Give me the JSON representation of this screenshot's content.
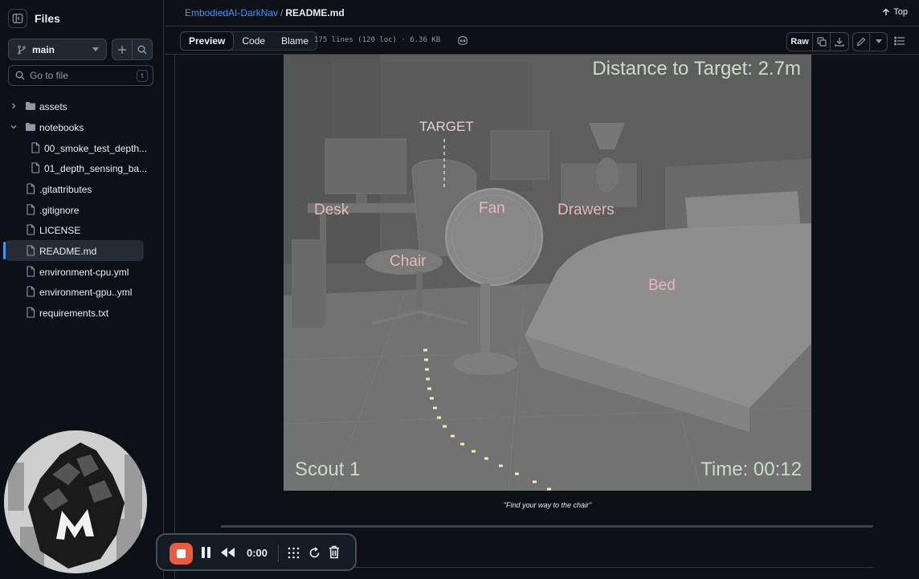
{
  "sidebar": {
    "title": "Files",
    "branch": "main",
    "goto_placeholder": "Go to file",
    "goto_shortcut": "t",
    "tree": [
      {
        "label": "assets",
        "type": "folder",
        "expanded": false
      },
      {
        "label": "notebooks",
        "type": "folder",
        "expanded": true
      },
      {
        "label": "00_smoke_test_depth...",
        "type": "file"
      },
      {
        "label": "01_depth_sensing_ba...",
        "type": "file"
      },
      {
        "label": ".gitattributes",
        "type": "file"
      },
      {
        "label": ".gitignore",
        "type": "file"
      },
      {
        "label": "LICENSE",
        "type": "file"
      },
      {
        "label": "README.md",
        "type": "file",
        "active": true
      },
      {
        "label": "environment-cpu.yml",
        "type": "file"
      },
      {
        "label": "environment-gpu..yml",
        "type": "file"
      },
      {
        "label": "requirements.txt",
        "type": "file"
      }
    ]
  },
  "header": {
    "repo": "EmbodiedAI-DarkNav",
    "separator": "/",
    "file": "README.md",
    "top_label": "Top"
  },
  "toolbar": {
    "tabs": [
      "Preview",
      "Code",
      "Blame"
    ],
    "selected_tab": "Preview",
    "meta": "175 lines (120 loc) · 6.36 KB",
    "raw_label": "Raw"
  },
  "scene": {
    "distance": "Distance to Target: 2.7m",
    "target": "TARGET",
    "labels": {
      "desk": "Desk",
      "fan": "Fan",
      "drawers": "Drawers",
      "chair": "Chair",
      "bed": "Bed"
    },
    "agent": "Scout 1",
    "time": "Time: 00:12",
    "label_color": "#e6b8b8",
    "hud_color": "#c8dcc8",
    "path_color": "#f0f0a0"
  },
  "caption": "\"Find your way to the chair\"",
  "recorder": {
    "time": "0:00",
    "stop_color": "#f05a3c"
  },
  "colors": {
    "background": "#0d1117",
    "link": "#4493f8",
    "border": "#30363d"
  }
}
